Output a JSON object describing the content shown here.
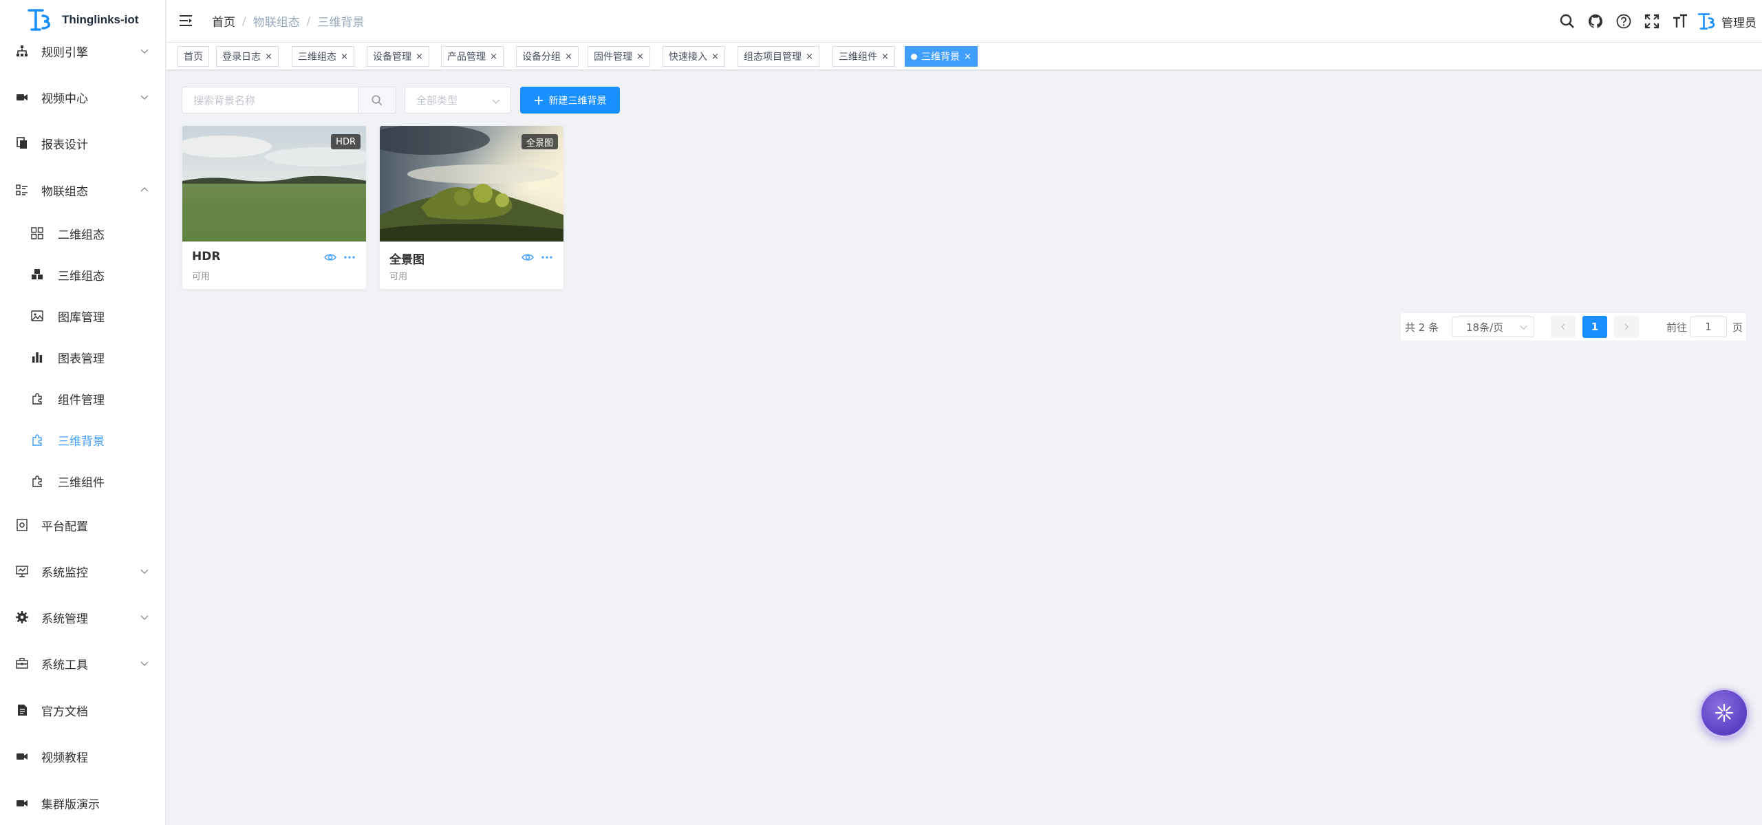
{
  "app": {
    "name": "Thinglinks-iot",
    "logo_icon": "thinglinks-logo-icon"
  },
  "sidebar": {
    "items": [
      {
        "label": "规则引擎",
        "icon": "sitemap-icon",
        "expandable": true
      },
      {
        "label": "视频中心",
        "icon": "video-camera-icon",
        "expandable": true
      },
      {
        "label": "报表设计",
        "icon": "report-copy-icon",
        "expandable": false
      },
      {
        "label": "物联组态",
        "icon": "list-icon",
        "expandable": true,
        "expanded": true
      },
      {
        "label": "二维组态",
        "icon": "grid-icon",
        "sub": true
      },
      {
        "label": "三维组态",
        "icon": "cubes-icon",
        "sub": true
      },
      {
        "label": "图库管理",
        "icon": "image-icon",
        "sub": true
      },
      {
        "label": "图表管理",
        "icon": "bar-chart-icon",
        "sub": true
      },
      {
        "label": "组件管理",
        "icon": "puzzle-icon",
        "sub": true
      },
      {
        "label": "三维背景",
        "icon": "puzzle-icon",
        "sub": true,
        "active": true
      },
      {
        "label": "三维组件",
        "icon": "puzzle-icon",
        "sub": true
      },
      {
        "label": "平台配置",
        "icon": "config-icon",
        "expandable": false
      },
      {
        "label": "系统监控",
        "icon": "monitor-icon",
        "expandable": true
      },
      {
        "label": "系统管理",
        "icon": "gear-icon",
        "expandable": true
      },
      {
        "label": "系统工具",
        "icon": "toolbox-icon",
        "expandable": true
      },
      {
        "label": "官方文档",
        "icon": "document-icon",
        "expandable": false
      },
      {
        "label": "视频教程",
        "icon": "video-camera-icon",
        "expandable": false
      },
      {
        "label": "集群版演示",
        "icon": "video-camera-icon",
        "expandable": false
      }
    ]
  },
  "header": {
    "breadcrumb": [
      "首页",
      "物联组态",
      "三维背景"
    ],
    "breadcrumb_separator": "/",
    "icons": [
      "search-icon",
      "github-icon",
      "help-icon",
      "fullscreen-icon",
      "font-size-icon"
    ],
    "user_name": "管理员"
  },
  "tags": [
    {
      "label": "首页",
      "closable": false
    },
    {
      "label": "登录日志",
      "closable": true
    },
    {
      "label": "三维组态",
      "closable": true
    },
    {
      "label": "设备管理",
      "closable": true
    },
    {
      "label": "产品管理",
      "closable": true
    },
    {
      "label": "设备分组",
      "closable": true
    },
    {
      "label": "固件管理",
      "closable": true
    },
    {
      "label": "快速接入",
      "closable": true
    },
    {
      "label": "组态项目管理",
      "closable": true
    },
    {
      "label": "三维组件",
      "closable": true
    },
    {
      "label": "三维背景",
      "closable": true,
      "active": true
    }
  ],
  "tag_close_glyph": "×",
  "toolbar": {
    "search_placeholder": "搜索背景名称",
    "type_placeholder": "全部类型",
    "new_button_label": "新建三维背景"
  },
  "cards": [
    {
      "title": "HDR",
      "badge": "HDR",
      "status": "可用",
      "image": "grassland-photo"
    },
    {
      "title": "全景图",
      "badge": "全景图",
      "status": "可用",
      "image": "hill-sunset-photo"
    }
  ],
  "pagination": {
    "total_text": "共 2 条",
    "page_size": "18条/页",
    "current_page": "1",
    "goto_label": "前往",
    "goto_value": "1",
    "page_label": "页"
  },
  "colors": {
    "accent": "#409eff",
    "primary_button": "#1890ff",
    "background": "#f0f2f5",
    "float_button": "#5b3fc4"
  }
}
